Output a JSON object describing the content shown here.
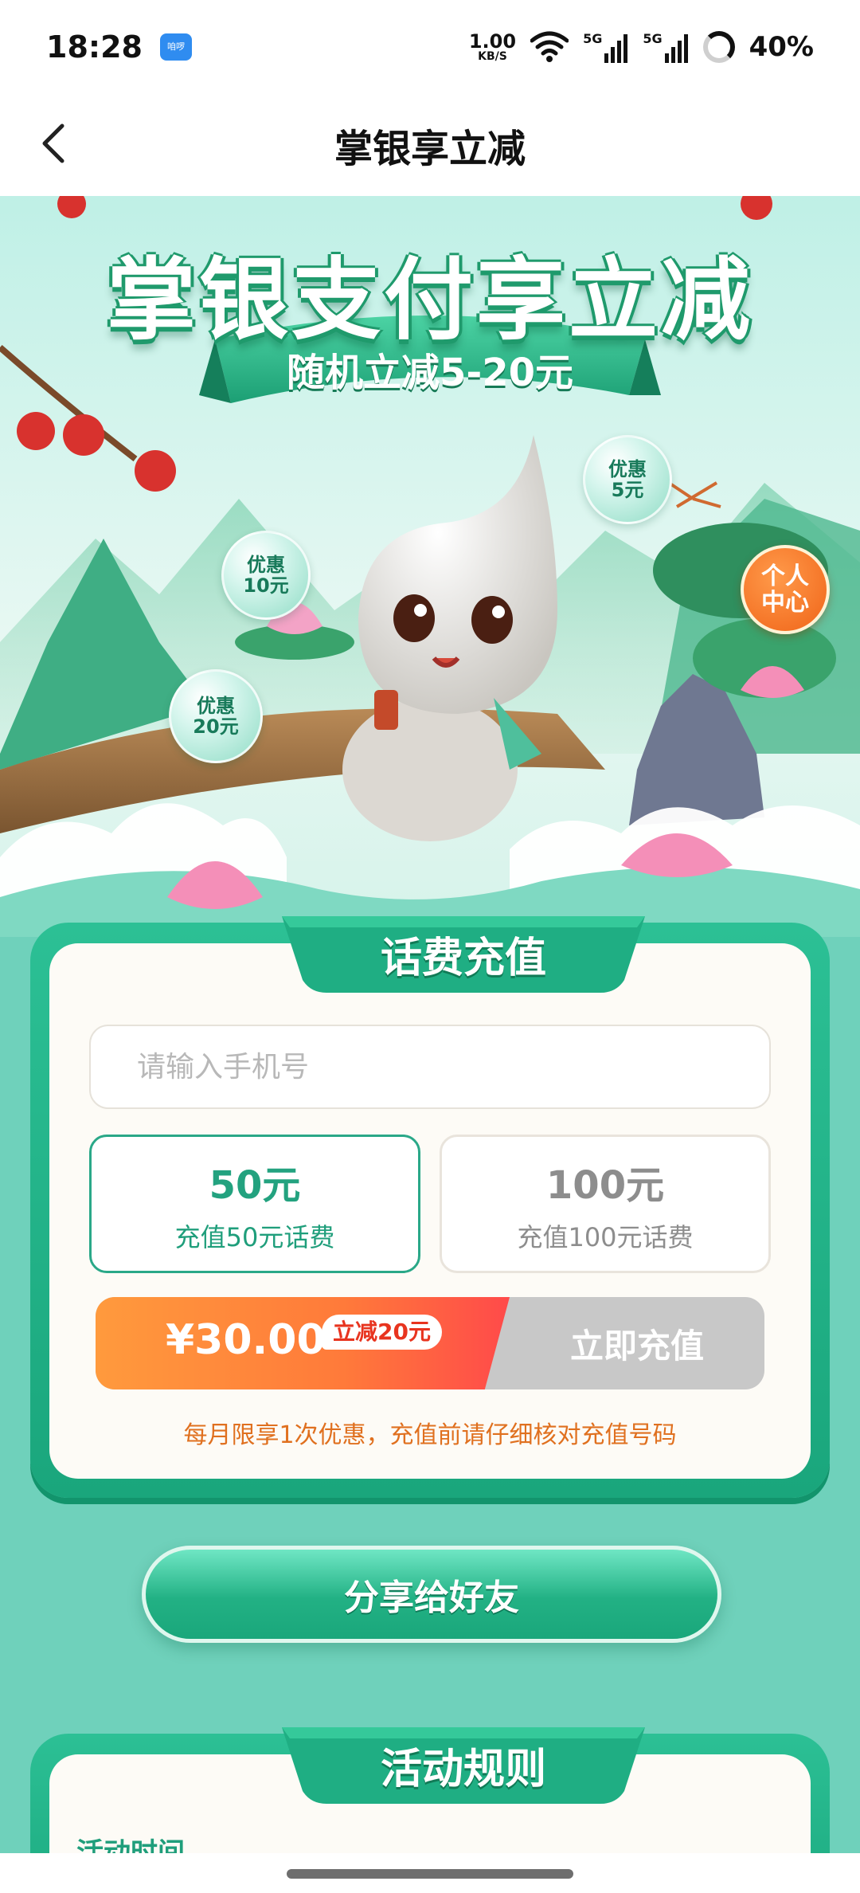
{
  "status_bar": {
    "time": "18:28",
    "app_icon_text": "咱啰",
    "network_speed": "1.00",
    "network_unit": "KB/S",
    "signal_1": "5G",
    "signal_2": "5G",
    "battery": "40%"
  },
  "nav": {
    "title": "掌银享立减",
    "back_icon": "chevron-left-icon"
  },
  "hero": {
    "title": "掌银支付享立减",
    "ribbon": "随机立减5-20元",
    "bubbles": [
      {
        "line1": "优惠",
        "line2": "5元"
      },
      {
        "line1": "优惠",
        "line2": "10元"
      },
      {
        "line1": "优惠",
        "line2": "20元"
      }
    ],
    "personal_center": {
      "line1": "个人",
      "line2": "中心"
    }
  },
  "recharge": {
    "tab_label": "话费充值",
    "phone_placeholder": "请输入手机号",
    "phone_value": "",
    "options": [
      {
        "amount": "50元",
        "desc": "充值50元话费",
        "selected": true
      },
      {
        "amount": "100元",
        "desc": "充值100元话费",
        "selected": false
      }
    ],
    "price": "¥30.00",
    "discount_badge": "立减20元",
    "pay_button": "立即充值",
    "notice": "每月限享1次优惠，充值前请仔细核对充值号码"
  },
  "share": {
    "button": "分享给好友"
  },
  "rules": {
    "tab_label": "活动规则",
    "section_title": "活动时间"
  },
  "colors": {
    "primary_green": "#23a27f",
    "background": "#6fd1bb",
    "pay_orange": "#ff7a3a",
    "notice_orange": "#e0701f",
    "discount_red": "#e8341f"
  }
}
